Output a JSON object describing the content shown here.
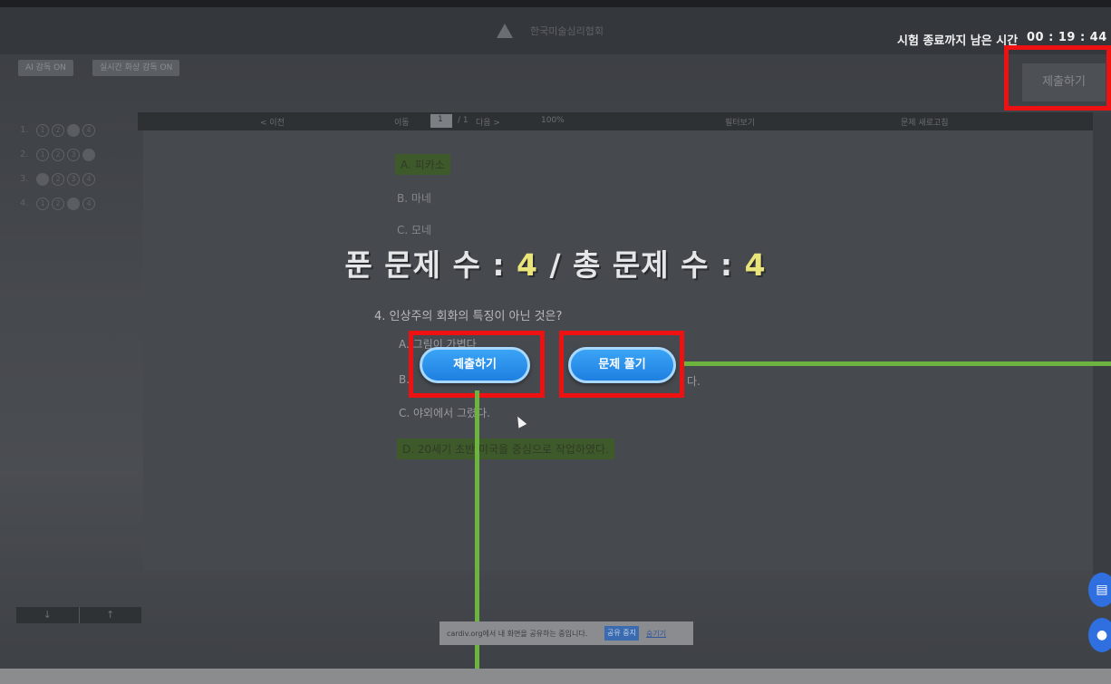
{
  "header": {
    "logo_text": "한국미술심리협회",
    "timer_label": "시험 종료까지 남은 시간",
    "timer_value": "00 : 19 : 44",
    "submit_label": "제출하기"
  },
  "toggles": [
    "AI 감독 ON",
    "실시간 화상 감독 ON"
  ],
  "sidebar": {
    "rows": [
      {
        "num": "1.",
        "marks": [
          "1",
          "2",
          "3",
          "4"
        ],
        "filled": 3
      },
      {
        "num": "2.",
        "marks": [
          "1",
          "2",
          "3",
          "4"
        ],
        "filled": 4
      },
      {
        "num": "3.",
        "marks": [
          "1",
          "2",
          "3",
          "4"
        ],
        "filled": 1
      },
      {
        "num": "4.",
        "marks": [
          "1",
          "2",
          "3",
          "4"
        ],
        "filled": 3
      }
    ]
  },
  "toolbar": {
    "prev": "< 이전",
    "page": "1",
    "page_total": "/ 1",
    "next": "다음 >",
    "move": "이동",
    "zoom": "100%",
    "view": "필터보기",
    "refresh": "문제 새로고침"
  },
  "content": {
    "q3_options": [
      "A. 피카소",
      "B. 마네",
      "C. 모네"
    ],
    "q4_question": "4. 인상주의 회화의 특징이 아닌 것은?",
    "q4_options": [
      "A. 그림이 가볍다",
      "B.",
      "C. 야외에서 그렸다.",
      "D. 20세기 초반 미국을 중심으로 작업하였다."
    ],
    "q4_option_b_tail": "다."
  },
  "overlay": {
    "solved_label": "푼 문제 수 : ",
    "solved_count": "4",
    "sep": " / 총 문제 수 : ",
    "total_count": "4",
    "submit_button": "제출하기",
    "solve_button": "문제 풀기"
  },
  "nav": {
    "down": "↓",
    "up": "↑"
  },
  "share_bar": {
    "text": "cardiv.org에서 내 화면을 공유하는 중입니다.",
    "stop": "공유 중지",
    "hide": "숨기기"
  },
  "colors": {
    "accent_blue": "#1e7fe0",
    "annotation_red": "#ee1111",
    "annotation_green": "#6db33f",
    "count_yellow": "#e9e57a"
  }
}
